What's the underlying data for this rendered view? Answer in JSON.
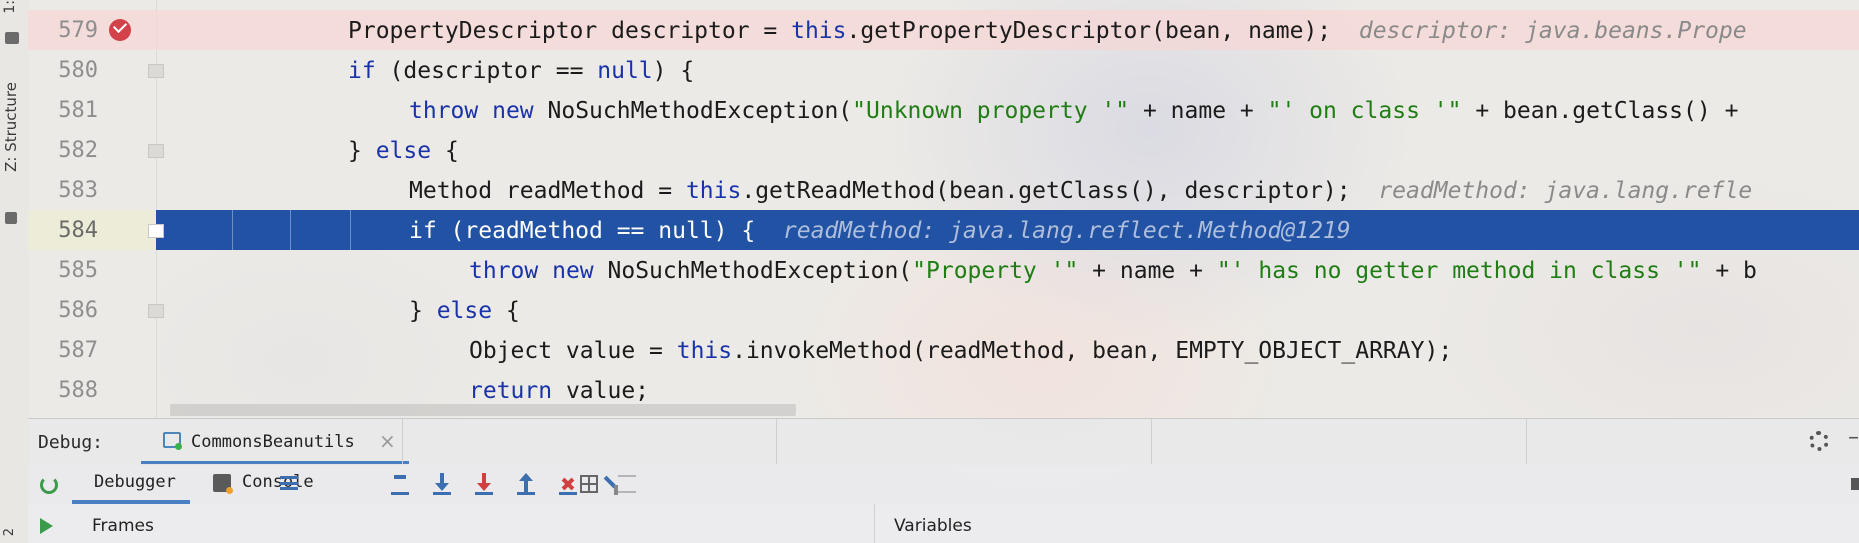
{
  "side_tabs": {
    "project": "1:",
    "structure": "Z: Structure",
    "bottom": "2"
  },
  "code_lines": [
    {
      "num": "579",
      "text": "PropertyDescriptor descriptor = this.getPropertyDescriptor(bean, name);",
      "hint": "descriptor: java.beans.Prope"
    },
    {
      "num": "580",
      "text": "if (descriptor == null) {"
    },
    {
      "num": "581",
      "text": "throw new NoSuchMethodException(\"Unknown property '\" + name + \"' on class '\" + bean.getClass() +"
    },
    {
      "num": "582",
      "text": "} else {"
    },
    {
      "num": "583",
      "text": "Method readMethod = this.getReadMethod(bean.getClass(), descriptor);",
      "hint": "readMethod: java.lang.refle"
    },
    {
      "num": "584",
      "text": "if (readMethod == null) {",
      "hint": "readMethod: java.lang.reflect.Method@1219"
    },
    {
      "num": "585",
      "text": "throw new NoSuchMethodException(\"Property '\" + name + \"' has no getter method in class '\" + b"
    },
    {
      "num": "586",
      "text": "} else {"
    },
    {
      "num": "587",
      "text": "Object value = this.invokeMethod(readMethod, bean, EMPTY_OBJECT_ARRAY);"
    },
    {
      "num": "588",
      "text": "return value;"
    }
  ],
  "code_tokens": {
    "l579": [
      "PropertyDescriptor descriptor = ",
      "this",
      ".getPropertyDescriptor(bean, name);"
    ],
    "l580": [
      "if",
      " (descriptor == ",
      "null",
      ") {"
    ],
    "l581": [
      "throw",
      " ",
      "new",
      " NoSuchMethodException(",
      "\"Unknown property '\"",
      " + name + ",
      "\"' on class '\"",
      " + bean.getClass() +"
    ],
    "l582": [
      "} ",
      "else",
      " {"
    ],
    "l583": [
      "Method readMethod = ",
      "this",
      ".getReadMethod(bean.getClass(), descriptor);"
    ],
    "l584": [
      "if (readMethod == null) {"
    ],
    "l585": [
      "throw",
      " ",
      "new",
      " NoSuchMethodException(",
      "\"Property '\"",
      " + name + ",
      "\"' has no getter method in class '\"",
      " + b"
    ],
    "l586": [
      "} ",
      "else",
      " {"
    ],
    "l587": [
      "Object value = ",
      "this",
      ".invokeMethod(readMethod, bean, EMPTY_OBJECT_ARRAY);"
    ],
    "l588": [
      "return",
      " value;"
    ]
  },
  "debug": {
    "label": "Debug:",
    "session_tab": "CommonsBeanutils",
    "close": "×",
    "minimize": "–"
  },
  "toolbar": {
    "debugger_tab": "Debugger",
    "console_tab": "Console"
  },
  "panels": {
    "frames": "Frames",
    "variables": "Variables"
  },
  "colors": {
    "keyword": "#1a33a8",
    "string": "#1f7d14",
    "execution_line": "#2152a3",
    "breakpoint_line": "#f6d6d4",
    "breakpoint_icon": "#d3414b"
  }
}
